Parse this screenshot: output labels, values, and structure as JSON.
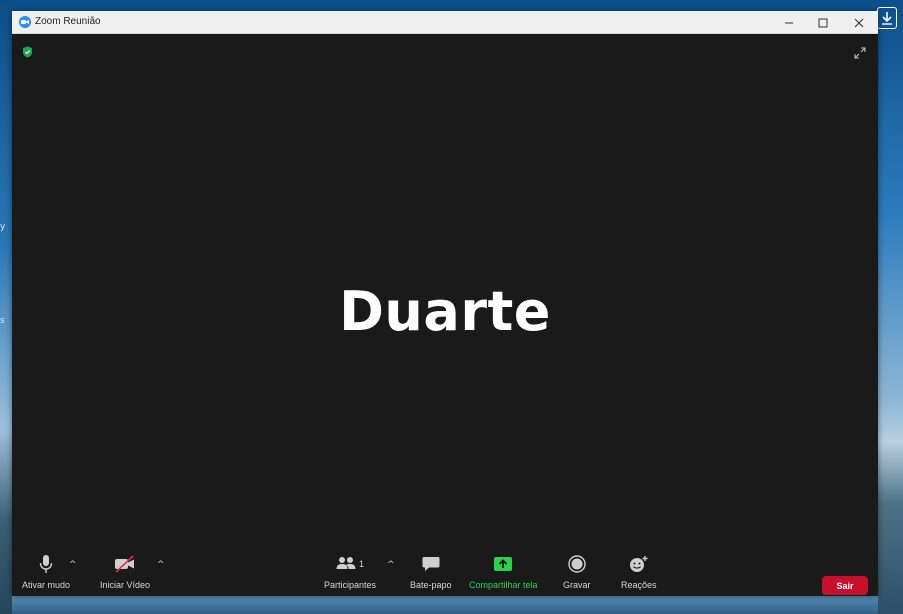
{
  "window": {
    "title": "Zoom Reunião"
  },
  "participant": {
    "name": "Duarte"
  },
  "toolbar": {
    "mute_label": "Ativar mudo",
    "video_label": "Iniciar Vídeo",
    "participants_label": "Participantes",
    "participants_count": "1",
    "chat_label": "Bate-papo",
    "share_label": "Compartilhar tela",
    "record_label": "Gravar",
    "reactions_label": "Reações",
    "leave_label": "Sair"
  },
  "desktop": {
    "left_marks": [
      "y",
      "s"
    ]
  },
  "icons": {
    "app": "zoom-logo-icon",
    "security": "shield-icon",
    "fullscreen": "expand-icon",
    "download": "download-icon"
  },
  "colors": {
    "share_green": "#2bd14f",
    "leave_red": "#c8102e",
    "zoom_blue": "#2d8cff",
    "shield_green": "#23a455"
  }
}
